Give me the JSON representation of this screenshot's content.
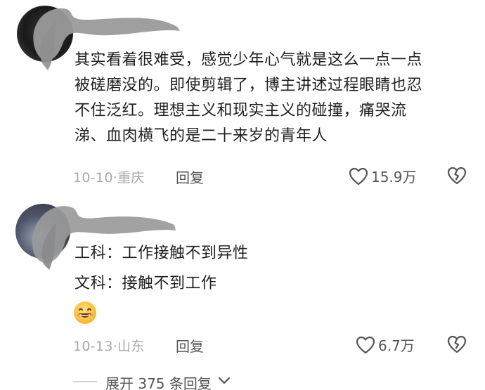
{
  "comments": [
    {
      "text": "其实看着很难受，感觉少年心气就是这么一点一点被磋磨没的。即使剪辑了，博主讲述过程眼睛也忍不住泛红。理想主义和现实主义的碰撞，痛哭流涕、血肉横飞的是二十来岁的青年人",
      "lines": [
        "其实看着很难受，感觉少年心气就是这么一点一点",
        "被磋磨没的。即使剪辑了，博主讲述过程眼睛也忍",
        "不住泛红。理想主义和现实主义的碰撞，痛哭流",
        "涕、血肉横飞的是二十来岁的青年人"
      ],
      "meta": "10-10·重庆",
      "reply_label": "回复",
      "likes": "15.9万"
    },
    {
      "lines": [
        "工科：工作接触不到异性",
        "文科：接触不到工作"
      ],
      "emoji": "grinning-face-emoji",
      "meta": "10-13·山东",
      "reply_label": "回复",
      "likes": "6.7万"
    }
  ],
  "expand_replies": {
    "label": "展开 375 条回复"
  },
  "icons": {
    "like": "heart-outline-icon",
    "dislike": "broken-heart-outline-icon",
    "expand": "chevron-down-icon"
  },
  "colors": {
    "text": "#1f1f1f",
    "meta": "#a8a8a8",
    "action": "#555555",
    "redaction": "#9a9a9a"
  }
}
